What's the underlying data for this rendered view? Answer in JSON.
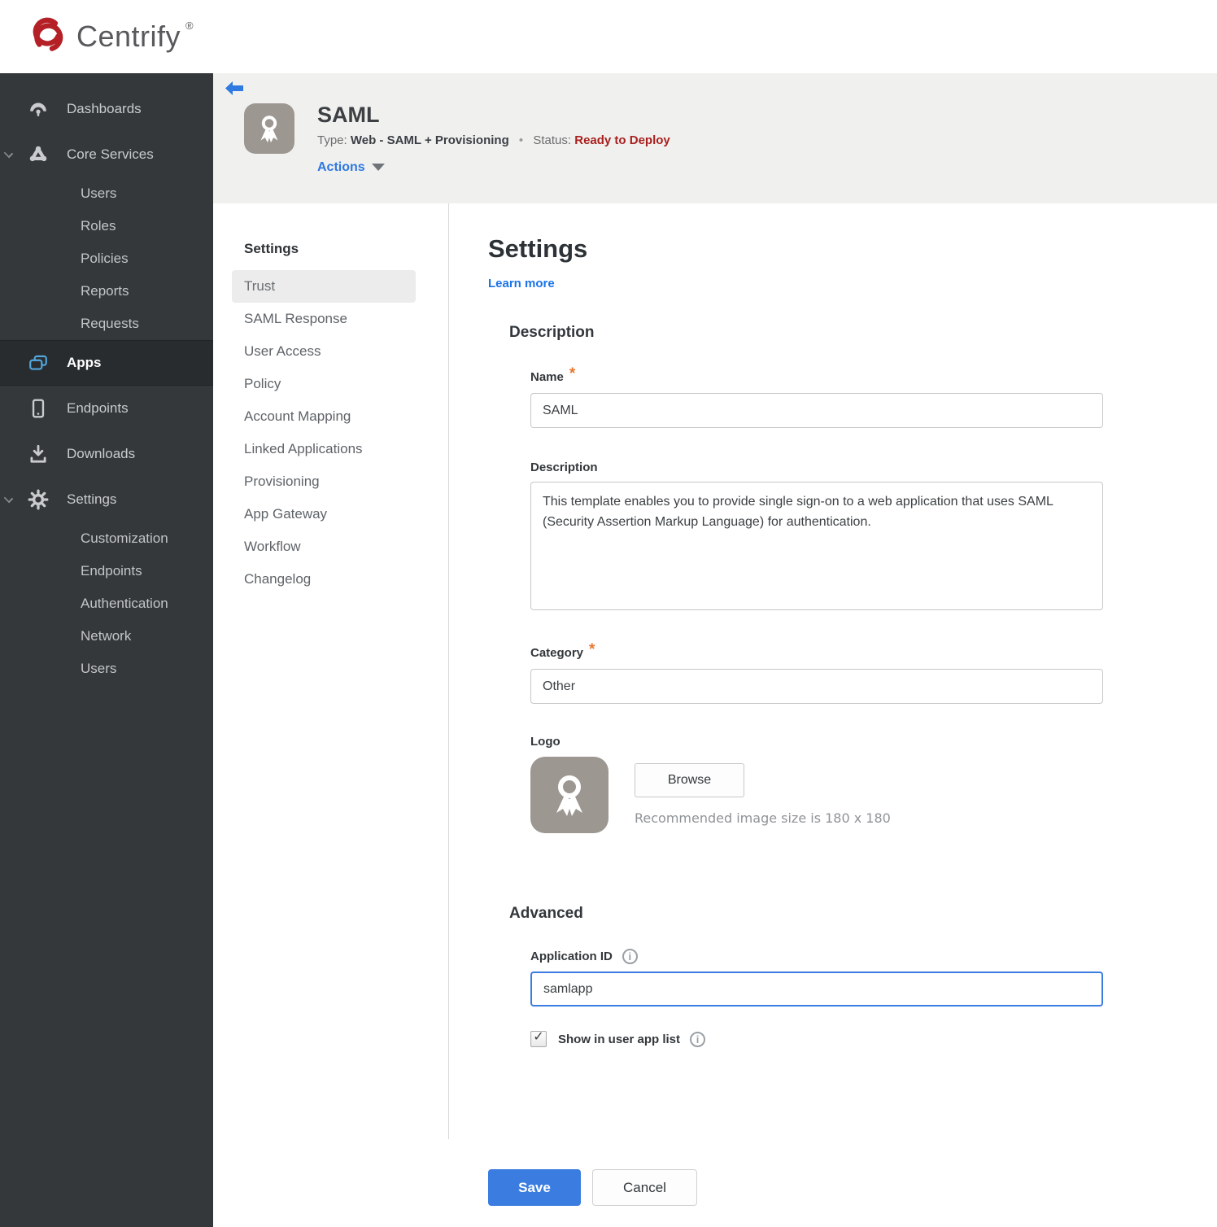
{
  "brand": {
    "name": "Centrify",
    "registered": "®"
  },
  "sidebar": {
    "dashboards": "Dashboards",
    "core_services": "Core Services",
    "core_children": [
      "Users",
      "Roles",
      "Policies",
      "Reports",
      "Requests"
    ],
    "apps": "Apps",
    "endpoints": "Endpoints",
    "downloads": "Downloads",
    "settings": "Settings",
    "settings_children": [
      "Customization",
      "Endpoints",
      "Authentication",
      "Network",
      "Users"
    ]
  },
  "header": {
    "title": "SAML",
    "type_label": "Type:",
    "type_value": "Web - SAML + Provisioning",
    "separator": "•",
    "status_label": "Status:",
    "status_value": "Ready to Deploy",
    "actions_label": "Actions"
  },
  "subnav": {
    "heading": "Settings",
    "selected": "Trust",
    "items": [
      "Trust",
      "SAML Response",
      "User Access",
      "Policy",
      "Account Mapping",
      "Linked Applications",
      "Provisioning",
      "App Gateway",
      "Workflow",
      "Changelog"
    ]
  },
  "main": {
    "title": "Settings",
    "learn_more": "Learn more",
    "description_section": "Description",
    "name_label": "Name",
    "required_marker": "*",
    "name_value": "SAML",
    "description_label": "Description",
    "description_value": "This template enables you to provide single sign-on to a web application that uses SAML (Security Assertion Markup Language) for authentication.",
    "category_label": "Category",
    "category_value": "Other",
    "logo_label": "Logo",
    "browse_button": "Browse",
    "logo_hint": "Recommended image size is 180 x 180",
    "advanced_section": "Advanced",
    "app_id_label": "Application ID",
    "app_id_value": "samlapp",
    "show_in_list_label": "Show in user app list",
    "save_button": "Save",
    "cancel_button": "Cancel"
  },
  "icons": {
    "check": "✓",
    "info": "i"
  },
  "colors": {
    "brand_red": "#b42025",
    "sidebar_bg": "#34383b",
    "sidebar_selected": "#282c2f",
    "header_bg": "#f0f0ef",
    "accent_blue": "#3a7ce0",
    "link_blue": "#1a73e8",
    "status_red": "#a8201d",
    "apps_icon_blue": "#53a7dc",
    "required_orange": "#e8772e"
  }
}
